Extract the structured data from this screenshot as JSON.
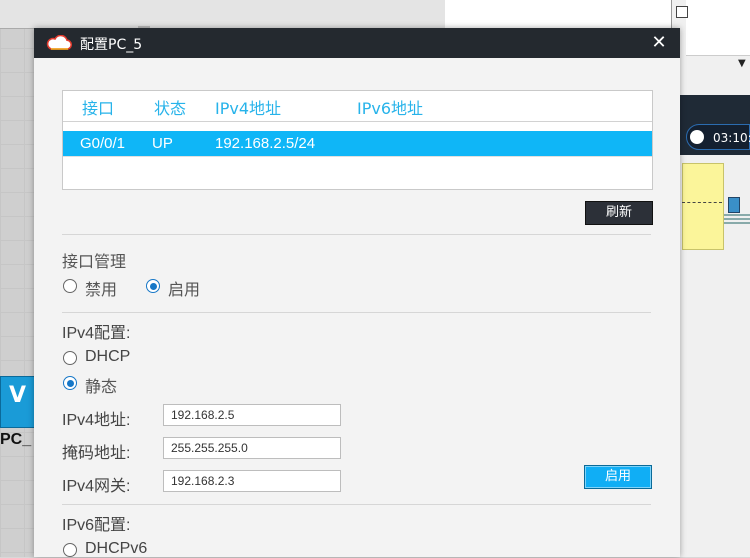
{
  "dialog": {
    "title": "配置PC_5",
    "close_glyph": "✕"
  },
  "interface_table": {
    "headers": [
      "接口",
      "状态",
      "IPv4地址",
      "IPv6地址"
    ],
    "rows": [
      {
        "interface": "G0/0/1",
        "status": "UP",
        "ipv4": "192.168.2.5/24",
        "ipv6": ""
      }
    ]
  },
  "refresh_button": "刷新",
  "interface_mgmt": {
    "title": "接口管理",
    "disable_label": "禁用",
    "enable_label": "启用",
    "selected": "enable"
  },
  "ipv4_config": {
    "title": "IPv4配置:",
    "dhcp_label": "DHCP",
    "static_label": "静态",
    "selected": "static",
    "address_label": "IPv4地址:",
    "address_value": "192.168.2.5",
    "mask_label": "掩码地址:",
    "mask_value": "255.255.255.0",
    "gateway_label": "IPv4网关:",
    "gateway_value": "192.168.2.3",
    "apply_button": "启用"
  },
  "ipv6_config": {
    "title": "IPv6配置:",
    "dhcpv6_label": "DHCPv6"
  },
  "background": {
    "pc_label": "PC_",
    "clock": "03:10:"
  },
  "colors": {
    "titlebar": "#24292f",
    "header_text": "#27b3ea",
    "selected_row": "#0fb6f7",
    "apply_button": "#10aef5"
  }
}
